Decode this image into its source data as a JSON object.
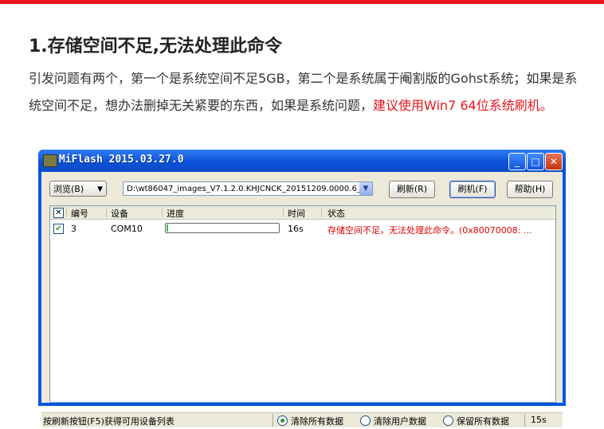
{
  "heading": "1.存储空间不足,无法处理此命令",
  "paragraph": {
    "normal": "引发问题有两个，第一个是系统空间不足5GB，第二个是系统属于阉割版的Gohst系统；如果是系统空间不足，想办法删掉无关紧要的东西，如果是系统问题，",
    "highlight": "建议使用Win7 64位系统刷机。"
  },
  "window": {
    "title": "MiFlash 2015.03.27.0",
    "minimize_glyph": "_",
    "maximize_glyph": "□",
    "close_glyph": "✕"
  },
  "toolbar": {
    "browse_label": "浏览(B)",
    "path_value": "D:\\wt86047_images_V7.1.2.0.KHJCNCK_20151209.0000.6_",
    "refresh_label": "刷新(R)",
    "flash_label": "刷机(F)",
    "help_label": "帮助(H)"
  },
  "table": {
    "headers": [
      "编号",
      "设备",
      "进度",
      "时间",
      "状态"
    ],
    "rows": [
      {
        "id": "3",
        "device": "COM10",
        "progress": 0.01,
        "time": "16s",
        "status": "存储空间不足，无法处理此命令。(0x80070008: ..."
      }
    ]
  },
  "statusbar": {
    "hint": "按刷新按钮(F5)获得可用设备列表",
    "options": [
      "清除所有数据",
      "清除用户数据",
      "保留所有数据"
    ],
    "selected_option": 0,
    "time": "15s"
  },
  "colors": {
    "accent_red": "#e8141b",
    "title_blue": "#0b52d8",
    "status_red": "#dd0000"
  }
}
